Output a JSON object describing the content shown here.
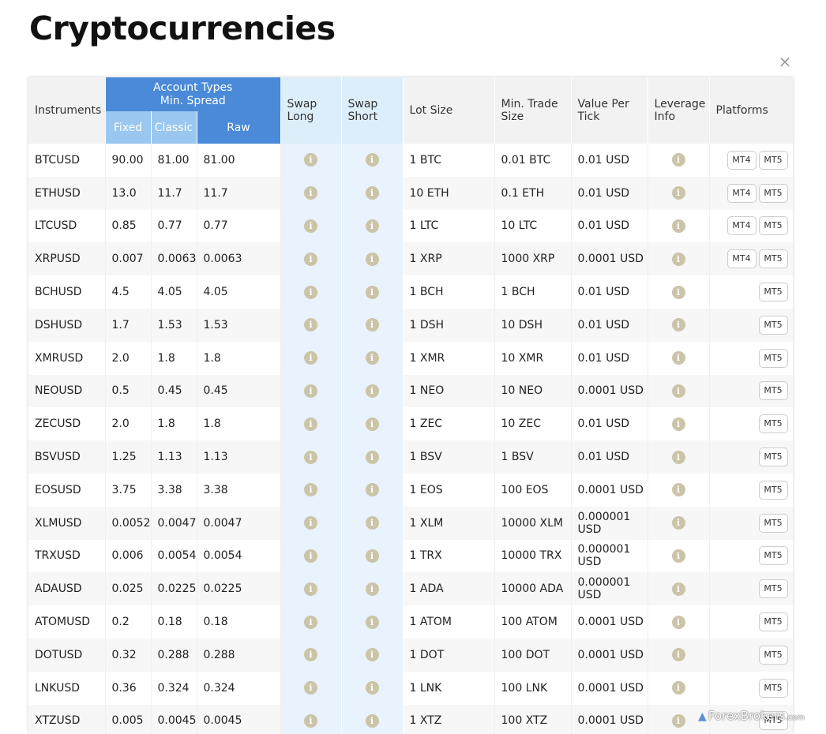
{
  "page": {
    "title": "Cryptocurrencies",
    "close_label": "×"
  },
  "table": {
    "headers": {
      "instruments": "Instruments",
      "account_types": "Account Types",
      "min_spread": "Min. Spread",
      "fixed": "Fixed",
      "classic": "Classic",
      "raw": "Raw",
      "swap_long_1": "Swap",
      "swap_long_2": "Long",
      "swap_short_1": "Swap",
      "swap_short_2": "Short",
      "lot_size": "Lot Size",
      "min_trade_1": "Min. Trade",
      "min_trade_2": "Size",
      "value_tick_1": "Value Per",
      "value_tick_2": "Tick",
      "leverage_1": "Leverage",
      "leverage_2": "Info",
      "platforms": "Platforms"
    },
    "info_icon_glyph": "i",
    "rows": [
      {
        "instrument": "BTCUSD",
        "fixed": "90.00",
        "classic": "81.00",
        "raw": "81.00",
        "lot": "1 BTC",
        "min_trade": "0.01 BTC",
        "value_tick": "0.01 USD",
        "platforms": [
          "MT4",
          "MT5"
        ]
      },
      {
        "instrument": "ETHUSD",
        "fixed": "13.0",
        "classic": "11.7",
        "raw": "11.7",
        "lot": "10 ETH",
        "min_trade": "0.1 ETH",
        "value_tick": "0.01 USD",
        "platforms": [
          "MT4",
          "MT5"
        ]
      },
      {
        "instrument": "LTCUSD",
        "fixed": "0.85",
        "classic": "0.77",
        "raw": "0.77",
        "lot": "1 LTC",
        "min_trade": "10 LTC",
        "value_tick": "0.01 USD",
        "platforms": [
          "MT4",
          "MT5"
        ]
      },
      {
        "instrument": "XRPUSD",
        "fixed": "0.007",
        "classic": "0.0063",
        "raw": "0.0063",
        "lot": "1 XRP",
        "min_trade": "1000 XRP",
        "value_tick": "0.0001 USD",
        "platforms": [
          "MT4",
          "MT5"
        ]
      },
      {
        "instrument": "BCHUSD",
        "fixed": "4.5",
        "classic": "4.05",
        "raw": "4.05",
        "lot": "1 BCH",
        "min_trade": "1 BCH",
        "value_tick": "0.01 USD",
        "platforms": [
          "MT5"
        ]
      },
      {
        "instrument": "DSHUSD",
        "fixed": "1.7",
        "classic": "1.53",
        "raw": "1.53",
        "lot": "1 DSH",
        "min_trade": "10 DSH",
        "value_tick": "0.01 USD",
        "platforms": [
          "MT5"
        ]
      },
      {
        "instrument": "XMRUSD",
        "fixed": "2.0",
        "classic": "1.8",
        "raw": "1.8",
        "lot": "1 XMR",
        "min_trade": "10 XMR",
        "value_tick": "0.01 USD",
        "platforms": [
          "MT5"
        ]
      },
      {
        "instrument": "NEOUSD",
        "fixed": "0.5",
        "classic": "0.45",
        "raw": "0.45",
        "lot": "1 NEO",
        "min_trade": "10 NEO",
        "value_tick": "0.0001 USD",
        "platforms": [
          "MT5"
        ]
      },
      {
        "instrument": "ZECUSD",
        "fixed": "2.0",
        "classic": "1.8",
        "raw": "1.8",
        "lot": "1 ZEC",
        "min_trade": "10 ZEC",
        "value_tick": "0.01 USD",
        "platforms": [
          "MT5"
        ]
      },
      {
        "instrument": "BSVUSD",
        "fixed": "1.25",
        "classic": "1.13",
        "raw": "1.13",
        "lot": "1 BSV",
        "min_trade": "1 BSV",
        "value_tick": "0.01 USD",
        "platforms": [
          "MT5"
        ]
      },
      {
        "instrument": "EOSUSD",
        "fixed": "3.75",
        "classic": "3.38",
        "raw": "3.38",
        "lot": "1 EOS",
        "min_trade": "100 EOS",
        "value_tick": "0.0001 USD",
        "platforms": [
          "MT5"
        ]
      },
      {
        "instrument": "XLMUSD",
        "fixed": "0.0052",
        "classic": "0.0047",
        "raw": "0.0047",
        "lot": "1 XLM",
        "min_trade": "10000 XLM",
        "value_tick": "0.000001 USD",
        "platforms": [
          "MT5"
        ]
      },
      {
        "instrument": "TRXUSD",
        "fixed": "0.006",
        "classic": "0.0054",
        "raw": "0.0054",
        "lot": "1 TRX",
        "min_trade": "10000 TRX",
        "value_tick": "0.000001 USD",
        "platforms": [
          "MT5"
        ]
      },
      {
        "instrument": "ADAUSD",
        "fixed": "0.025",
        "classic": "0.0225",
        "raw": "0.0225",
        "lot": "1 ADA",
        "min_trade": "10000 ADA",
        "value_tick": "0.000001 USD",
        "platforms": [
          "MT5"
        ]
      },
      {
        "instrument": "ATOMUSD",
        "fixed": "0.2",
        "classic": "0.18",
        "raw": "0.18",
        "lot": "1 ATOM",
        "min_trade": "100 ATOM",
        "value_tick": "0.0001 USD",
        "platforms": [
          "MT5"
        ]
      },
      {
        "instrument": "DOTUSD",
        "fixed": "0.32",
        "classic": "0.288",
        "raw": "0.288",
        "lot": "1 DOT",
        "min_trade": "100 DOT",
        "value_tick": "0.0001 USD",
        "platforms": [
          "MT5"
        ]
      },
      {
        "instrument": "LNKUSD",
        "fixed": "0.36",
        "classic": "0.324",
        "raw": "0.324",
        "lot": "1 LNK",
        "min_trade": "100 LNK",
        "value_tick": "0.0001 USD",
        "platforms": [
          "MT5"
        ]
      },
      {
        "instrument": "XTZUSD",
        "fixed": "0.005",
        "classic": "0.0045",
        "raw": "0.0045",
        "lot": "1 XTZ",
        "min_trade": "100 XTZ",
        "value_tick": "0.0001 USD",
        "platforms": [
          "MT5"
        ]
      }
    ]
  },
  "watermark": {
    "text": "ForexBrokers",
    "suffix": ".com"
  },
  "colors": {
    "header_blue": "#4a8ad8",
    "header_light_blue": "#9ac7f0",
    "swap_column_bg": "#e8f3fd",
    "info_icon": "#ccc4a8"
  }
}
